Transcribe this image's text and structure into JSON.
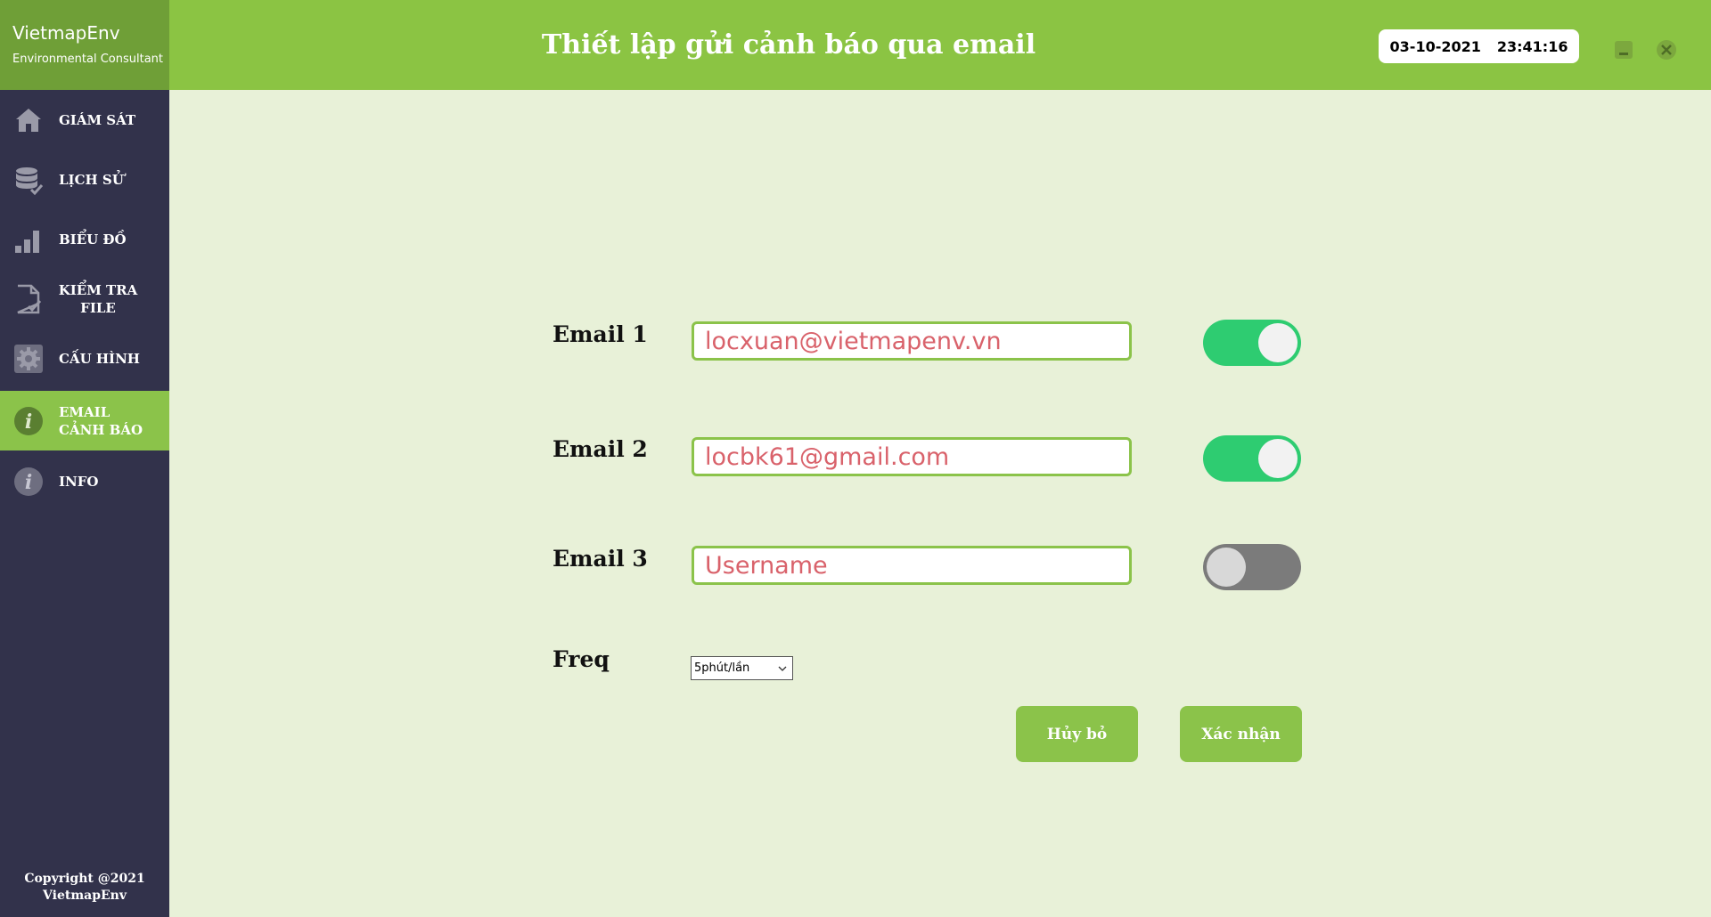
{
  "brand": {
    "name": "VietmapEnv",
    "subtitle": "Environmental Consultant"
  },
  "sidebar": {
    "items": [
      {
        "label": "GIÁM SÁT",
        "icon": "home-icon"
      },
      {
        "label": "LỊCH SỬ",
        "icon": "database-icon"
      },
      {
        "label": "BIỂU ĐỒ",
        "icon": "bar-chart-icon"
      },
      {
        "label_line1": "KIỂM TRA",
        "label_line2": "FILE",
        "icon": "file-check-icon"
      },
      {
        "label": "CẤU HÌNH",
        "icon": "gear-icon"
      },
      {
        "label_line1": "EMAIL",
        "label_line2": "CẢNH BÁO",
        "icon": "info-icon",
        "active": true
      },
      {
        "label": "INFO",
        "icon": "info-icon"
      }
    ],
    "copyright_line1": "Copyright @2021",
    "copyright_line2": "VietmapEnv"
  },
  "header": {
    "title": "Thiết lập gửi cảnh báo qua email",
    "date": "03-10-2021",
    "time": "23:41:16"
  },
  "form": {
    "email1": {
      "label": "Email 1",
      "value": "locxuan@vietmapenv.vn",
      "placeholder": "Username",
      "enabled": true
    },
    "email2": {
      "label": "Email 2",
      "value": "locbk61@gmail.com",
      "placeholder": "Username",
      "enabled": true
    },
    "email3": {
      "label": "Email 3",
      "value": "",
      "placeholder": "Username",
      "enabled": false
    },
    "freq": {
      "label": "Freq",
      "selected": "5phút/lần"
    },
    "cancel_label": "Hủy bỏ",
    "confirm_label": "Xác nhận"
  },
  "colors": {
    "header_green": "#8bc443",
    "brand_green": "#6f9f37",
    "sidebar_bg": "#32324b",
    "content_bg": "#e8f1d8",
    "toggle_on": "#2ecc71",
    "toggle_off": "#7b7b7b",
    "input_text": "#d9626b"
  }
}
